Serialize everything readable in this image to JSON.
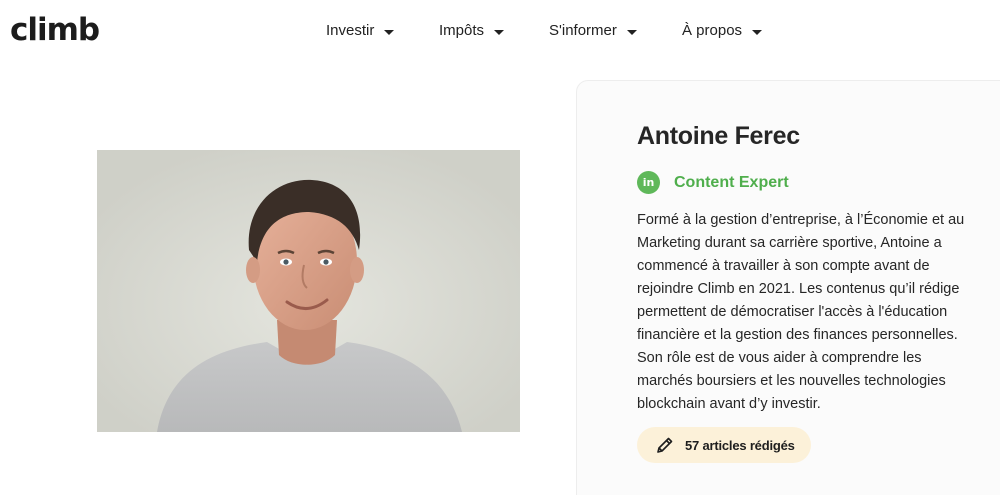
{
  "brand": {
    "logo_text": "climb"
  },
  "nav": {
    "items": [
      {
        "label": "Investir"
      },
      {
        "label": "Impôts"
      },
      {
        "label": "S'informer"
      },
      {
        "label": "À propos"
      }
    ]
  },
  "author": {
    "photo_icon": "person-portrait",
    "name": "Antoine Ferec",
    "linkedin_icon_text": "in",
    "role": "Content Expert",
    "bio_lines": [
      "Formé à la gestion d’entreprise, à l’Économie et au",
      "Marketing durant sa carrière sportive, Antoine a",
      "commencé à travailler à son compte avant de",
      "rejoindre Climb en 2021. Les contenus qu’il rédige",
      "permettent de démocratiser l'accès à l'éducation",
      "financière et la gestion des finances personnelles.",
      "Son rôle est de vous aider à comprendre les",
      "marchés boursiers et les nouvelles technologies",
      "blockchain avant d’y investir."
    ],
    "articles_label": "57 articles rédigés"
  },
  "colors": {
    "accent_green": "#4fae4c",
    "badge_bg": "#fcf1d9",
    "card_bg": "#fbfbfb"
  }
}
